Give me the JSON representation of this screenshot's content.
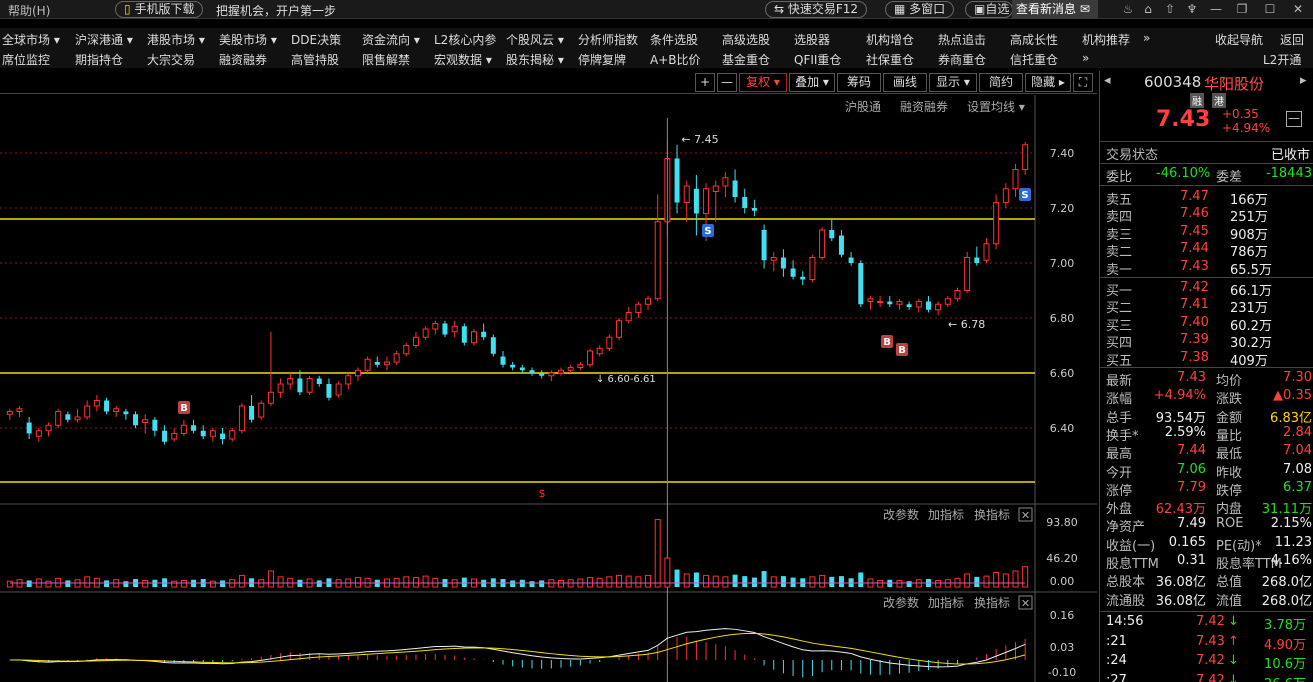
{
  "topbar": {
    "help": "帮助(H)",
    "mobile": "手机版下载",
    "slogan": "把握机会，开户第一步",
    "quick_trade": "快速交易F12",
    "multi_window": "多窗口",
    "self_select": "自选",
    "news": "查看新消息"
  },
  "menu_row1": [
    "全球市场 ▾",
    "沪深港通 ▾",
    "港股市场 ▾",
    "美股市场 ▾",
    "DDE决策",
    "资金流向 ▾",
    "L2核心内参",
    "个股风云 ▾",
    "分析师指数",
    "条件选股",
    "高级选股",
    "选股器",
    "机构增仓",
    "热点追击",
    "高成长性",
    "机构推荐",
    "»",
    "收起导航",
    "返回"
  ],
  "menu_row2": [
    "席位监控",
    "期指持仓",
    "大宗交易",
    "融资融券",
    "高管持股",
    "限售解禁",
    "宏观数据 ▾",
    "股东揭秘 ▾",
    "停牌复牌",
    "A+B比价",
    "基金重仓",
    "QFII重仓",
    "社保重仓",
    "券商重仓",
    "信托重仓",
    "»",
    "L2开通"
  ],
  "chart_toolbar": {
    "plus": "+",
    "minus": "—",
    "fuquan": "复权 ▾",
    "diejia": "叠加 ▾",
    "chouma": "筹码",
    "huaxian": "画线",
    "xianshi": "显示 ▾",
    "jianyue": "简约",
    "yincang": "隐藏 ▸",
    "fullscreen": "⛶"
  },
  "sub_toolbar": {
    "hgt": "沪股通",
    "rzrq": "融资融券",
    "setma": "设置均线 ▾"
  },
  "price_axis": [
    "7.40",
    "7.20",
    "7.00",
    "6.80",
    "6.60",
    "6.40"
  ],
  "annotations": {
    "high": "7.45",
    "low": "6.78",
    "range": "6.60-6.61",
    "s_marker": "S",
    "b_marker": "B",
    "dollar": "$"
  },
  "volume_panel": {
    "gaicanshu": "改参数",
    "jiazhibiao": "加指标",
    "huanzhibiao": "换指标",
    "axis": [
      "93.80",
      "46.20",
      "0.00"
    ]
  },
  "macd_panel": {
    "gaicanshu": "改参数",
    "jiazhibiao": "加指标",
    "huanzhibiao": "换指标",
    "axis": [
      "0.16",
      "0.03",
      "-0.10"
    ]
  },
  "chart_data": {
    "type": "candlestick",
    "title": "",
    "ylim": [
      6.25,
      7.5
    ],
    "candles": [
      [
        6.45,
        6.47,
        6.43,
        6.46
      ],
      [
        6.46,
        6.48,
        6.44,
        6.47
      ],
      [
        6.42,
        6.44,
        6.36,
        6.38
      ],
      [
        6.37,
        6.4,
        6.35,
        6.39
      ],
      [
        6.39,
        6.42,
        6.37,
        6.41
      ],
      [
        6.41,
        6.47,
        6.4,
        6.46
      ],
      [
        6.45,
        6.46,
        6.42,
        6.43
      ],
      [
        6.43,
        6.47,
        6.42,
        6.44
      ],
      [
        6.44,
        6.5,
        6.43,
        6.48
      ],
      [
        6.48,
        6.52,
        6.46,
        6.5
      ],
      [
        6.5,
        6.51,
        6.45,
        6.46
      ],
      [
        6.46,
        6.48,
        6.44,
        6.47
      ],
      [
        6.46,
        6.47,
        6.43,
        6.45
      ],
      [
        6.45,
        6.46,
        6.4,
        6.41
      ],
      [
        6.42,
        6.45,
        6.38,
        6.43
      ],
      [
        6.43,
        6.44,
        6.37,
        6.39
      ],
      [
        6.39,
        6.41,
        6.34,
        6.35
      ],
      [
        6.36,
        6.4,
        6.35,
        6.38
      ],
      [
        6.38,
        6.43,
        6.37,
        6.41
      ],
      [
        6.41,
        6.43,
        6.38,
        6.39
      ],
      [
        6.39,
        6.41,
        6.36,
        6.37
      ],
      [
        6.37,
        6.4,
        6.35,
        6.39
      ],
      [
        6.38,
        6.4,
        6.34,
        6.36
      ],
      [
        6.36,
        6.4,
        6.35,
        6.39
      ],
      [
        6.39,
        6.49,
        6.38,
        6.48
      ],
      [
        6.48,
        6.52,
        6.42,
        6.43
      ],
      [
        6.44,
        6.5,
        6.43,
        6.49
      ],
      [
        6.49,
        6.75,
        6.48,
        6.53
      ],
      [
        6.53,
        6.58,
        6.51,
        6.56
      ],
      [
        6.56,
        6.6,
        6.54,
        6.58
      ],
      [
        6.58,
        6.61,
        6.52,
        6.53
      ],
      [
        6.53,
        6.59,
        6.52,
        6.58
      ],
      [
        6.58,
        6.59,
        6.55,
        6.56
      ],
      [
        6.56,
        6.58,
        6.5,
        6.51
      ],
      [
        6.52,
        6.57,
        6.51,
        6.56
      ],
      [
        6.56,
        6.6,
        6.54,
        6.59
      ],
      [
        6.59,
        6.62,
        6.57,
        6.61
      ],
      [
        6.61,
        6.66,
        6.6,
        6.65
      ],
      [
        6.64,
        6.66,
        6.62,
        6.63
      ],
      [
        6.63,
        6.66,
        6.61,
        6.64
      ],
      [
        6.64,
        6.68,
        6.63,
        6.67
      ],
      [
        6.67,
        6.71,
        6.66,
        6.7
      ],
      [
        6.7,
        6.75,
        6.69,
        6.73
      ],
      [
        6.73,
        6.77,
        6.72,
        6.76
      ],
      [
        6.76,
        6.79,
        6.74,
        6.78
      ],
      [
        6.78,
        6.79,
        6.73,
        6.74
      ],
      [
        6.75,
        6.79,
        6.73,
        6.77
      ],
      [
        6.77,
        6.78,
        6.7,
        6.71
      ],
      [
        6.71,
        6.76,
        6.7,
        6.75
      ],
      [
        6.75,
        6.78,
        6.72,
        6.73
      ],
      [
        6.73,
        6.74,
        6.66,
        6.67
      ],
      [
        6.66,
        6.68,
        6.62,
        6.63
      ],
      [
        6.63,
        6.64,
        6.61,
        6.62
      ],
      [
        6.62,
        6.63,
        6.6,
        6.61
      ],
      [
        6.61,
        6.62,
        6.59,
        6.6
      ],
      [
        6.6,
        6.61,
        6.58,
        6.59
      ],
      [
        6.59,
        6.61,
        6.57,
        6.6
      ],
      [
        6.6,
        6.62,
        6.59,
        6.61
      ],
      [
        6.61,
        6.63,
        6.6,
        6.62
      ],
      [
        6.62,
        6.64,
        6.61,
        6.63
      ],
      [
        6.63,
        6.69,
        6.62,
        6.68
      ],
      [
        6.67,
        6.7,
        6.66,
        6.69
      ],
      [
        6.69,
        6.74,
        6.68,
        6.73
      ],
      [
        6.73,
        6.8,
        6.72,
        6.79
      ],
      [
        6.79,
        6.84,
        6.78,
        6.82
      ],
      [
        6.82,
        6.86,
        6.8,
        6.85
      ],
      [
        6.85,
        6.88,
        6.83,
        6.87
      ],
      [
        6.87,
        7.25,
        6.86,
        7.15
      ],
      [
        7.15,
        7.45,
        7.1,
        7.38
      ],
      [
        7.38,
        7.43,
        7.18,
        7.22
      ],
      [
        7.22,
        7.3,
        7.15,
        7.28
      ],
      [
        7.27,
        7.32,
        7.1,
        7.18
      ],
      [
        7.18,
        7.29,
        7.08,
        7.27
      ],
      [
        7.26,
        7.3,
        7.15,
        7.28
      ],
      [
        7.28,
        7.33,
        7.24,
        7.31
      ],
      [
        7.3,
        7.34,
        7.22,
        7.24
      ],
      [
        7.24,
        7.27,
        7.18,
        7.2
      ],
      [
        7.2,
        7.23,
        7.17,
        7.19
      ],
      [
        7.12,
        7.14,
        6.98,
        7.01
      ],
      [
        7.01,
        7.04,
        6.97,
        7.02
      ],
      [
        7.02,
        7.05,
        6.95,
        6.98
      ],
      [
        6.98,
        7.01,
        6.94,
        6.95
      ],
      [
        6.95,
        6.97,
        6.92,
        6.94
      ],
      [
        6.94,
        7.03,
        6.93,
        7.02
      ],
      [
        7.02,
        7.13,
        7.01,
        7.12
      ],
      [
        7.12,
        7.16,
        7.08,
        7.09
      ],
      [
        7.1,
        7.12,
        7.02,
        7.03
      ],
      [
        7.02,
        7.04,
        6.99,
        7.0
      ],
      [
        7.0,
        7.01,
        6.84,
        6.85
      ],
      [
        6.86,
        6.88,
        6.83,
        6.87
      ],
      [
        6.86,
        6.88,
        6.84,
        6.86
      ],
      [
        6.86,
        6.88,
        6.84,
        6.85
      ],
      [
        6.85,
        6.87,
        6.83,
        6.86
      ],
      [
        6.85,
        6.86,
        6.83,
        6.84
      ],
      [
        6.84,
        6.87,
        6.82,
        6.86
      ],
      [
        6.86,
        6.88,
        6.82,
        6.83
      ],
      [
        6.83,
        6.86,
        6.81,
        6.85
      ],
      [
        6.85,
        6.88,
        6.84,
        6.87
      ],
      [
        6.87,
        6.91,
        6.86,
        6.9
      ],
      [
        6.9,
        7.04,
        6.89,
        7.02
      ],
      [
        7.02,
        7.06,
        6.99,
        7.0
      ],
      [
        7.01,
        7.09,
        7.0,
        7.07
      ],
      [
        7.07,
        7.25,
        7.05,
        7.22
      ],
      [
        7.22,
        7.29,
        7.2,
        7.27
      ],
      [
        7.27,
        7.36,
        7.24,
        7.34
      ],
      [
        7.34,
        7.44,
        7.32,
        7.43
      ]
    ],
    "volume": [
      8,
      10,
      9,
      11,
      8,
      12,
      9,
      10,
      14,
      12,
      9,
      10,
      8,
      11,
      9,
      10,
      12,
      8,
      9,
      10,
      11,
      8,
      9,
      10,
      16,
      12,
      10,
      22,
      14,
      12,
      10,
      11,
      9,
      12,
      10,
      11,
      13,
      12,
      10,
      11,
      12,
      14,
      13,
      15,
      12,
      11,
      10,
      13,
      11,
      10,
      12,
      11,
      9,
      10,
      8,
      9,
      10,
      9,
      10,
      11,
      13,
      12,
      14,
      16,
      15,
      14,
      16,
      93,
      40,
      24,
      18,
      20,
      16,
      15,
      14,
      17,
      15,
      13,
      22,
      14,
      15,
      13,
      12,
      14,
      16,
      14,
      15,
      12,
      20,
      11,
      9,
      10,
      9,
      8,
      10,
      11,
      9,
      10,
      12,
      18,
      14,
      15,
      20,
      18,
      22,
      28
    ],
    "ma_lines": [
      6.6,
      7.16
    ],
    "low_line": 6.29,
    "mid_line": 6.4
  },
  "stock": {
    "code": "600348",
    "name": "华阳股份",
    "tag1": "融",
    "tag2": "港",
    "price": "7.43",
    "change": "+0.35",
    "pct": "+4.94%"
  },
  "status": {
    "label": "交易状态",
    "value": "已收市"
  },
  "weibi": {
    "label1": "委比",
    "value1": "-46.10%",
    "label2": "委差",
    "value2": "-18443"
  },
  "sells": [
    {
      "label": "卖五",
      "price": "7.47",
      "vol": "166万"
    },
    {
      "label": "卖四",
      "price": "7.46",
      "vol": "251万"
    },
    {
      "label": "卖三",
      "price": "7.45",
      "vol": "908万"
    },
    {
      "label": "卖二",
      "price": "7.44",
      "vol": "786万"
    },
    {
      "label": "卖一",
      "price": "7.43",
      "vol": "65.5万"
    }
  ],
  "buys": [
    {
      "label": "买一",
      "price": "7.42",
      "vol": "66.1万"
    },
    {
      "label": "买二",
      "price": "7.41",
      "vol": "231万"
    },
    {
      "label": "买三",
      "price": "7.40",
      "vol": "60.2万"
    },
    {
      "label": "买四",
      "price": "7.39",
      "vol": "30.2万"
    },
    {
      "label": "买五",
      "price": "7.38",
      "vol": "409万"
    }
  ],
  "stats": [
    {
      "l1": "最新",
      "v1": "7.43",
      "c1": "red",
      "l2": "均价",
      "v2": "7.30",
      "c2": "red"
    },
    {
      "l1": "涨幅",
      "v1": "+4.94%",
      "c1": "red",
      "l2": "涨跌",
      "v2": "▲0.35",
      "c2": "red"
    },
    {
      "l1": "总手",
      "v1": "93.54万",
      "c1": "white",
      "l2": "金额",
      "v2": "6.83亿",
      "c2": "yellow"
    },
    {
      "l1": "换手*",
      "v1": "2.59%",
      "c1": "white",
      "l2": "量比",
      "v2": "2.84",
      "c2": "red"
    },
    {
      "l1": "最高",
      "v1": "7.44",
      "c1": "red",
      "l2": "最低",
      "v2": "7.04",
      "c2": "red"
    },
    {
      "l1": "今开",
      "v1": "7.06",
      "c1": "green",
      "l2": "昨收",
      "v2": "7.08",
      "c2": "white"
    },
    {
      "l1": "涨停",
      "v1": "7.79",
      "c1": "red",
      "l2": "跌停",
      "v2": "6.37",
      "c2": "green"
    },
    {
      "l1": "外盘",
      "v1": "62.43万",
      "c1": "red",
      "l2": "内盘",
      "v2": "31.11万",
      "c2": "green"
    },
    {
      "l1": "净资产",
      "v1": "7.49",
      "c1": "white",
      "l2": "ROE",
      "v2": "2.15%",
      "c2": "white"
    },
    {
      "l1": "收益(一)",
      "v1": "0.165",
      "c1": "white",
      "l2": "PE(动)*",
      "v2": "11.23",
      "c2": "white"
    },
    {
      "l1": "股息TTM",
      "v1": "0.31",
      "c1": "white",
      "l2": "股息率TTM",
      "v2": "4.16%",
      "c2": "white"
    },
    {
      "l1": "总股本",
      "v1": "36.08亿",
      "c1": "white",
      "l2": "总值",
      "v2": "268.0亿",
      "c2": "white"
    },
    {
      "l1": "流通股",
      "v1": "36.08亿",
      "c1": "white",
      "l2": "流值",
      "v2": "268.0亿",
      "c2": "white"
    }
  ],
  "ticks": [
    {
      "time": "14:56",
      "price": "7.42",
      "arrow": "↓",
      "ac": "green",
      "vol": "3.78万",
      "vc": "green"
    },
    {
      "time": ":21",
      "price": "7.43",
      "arrow": "↑",
      "ac": "red",
      "vol": "4.90万",
      "vc": "red"
    },
    {
      "time": ":24",
      "price": "7.42",
      "arrow": "↓",
      "ac": "green",
      "vol": "10.6万",
      "vc": "green"
    },
    {
      "time": ":27",
      "price": "7.42",
      "arrow": "↓",
      "ac": "green",
      "vol": "26.6万",
      "vc": "green"
    }
  ]
}
